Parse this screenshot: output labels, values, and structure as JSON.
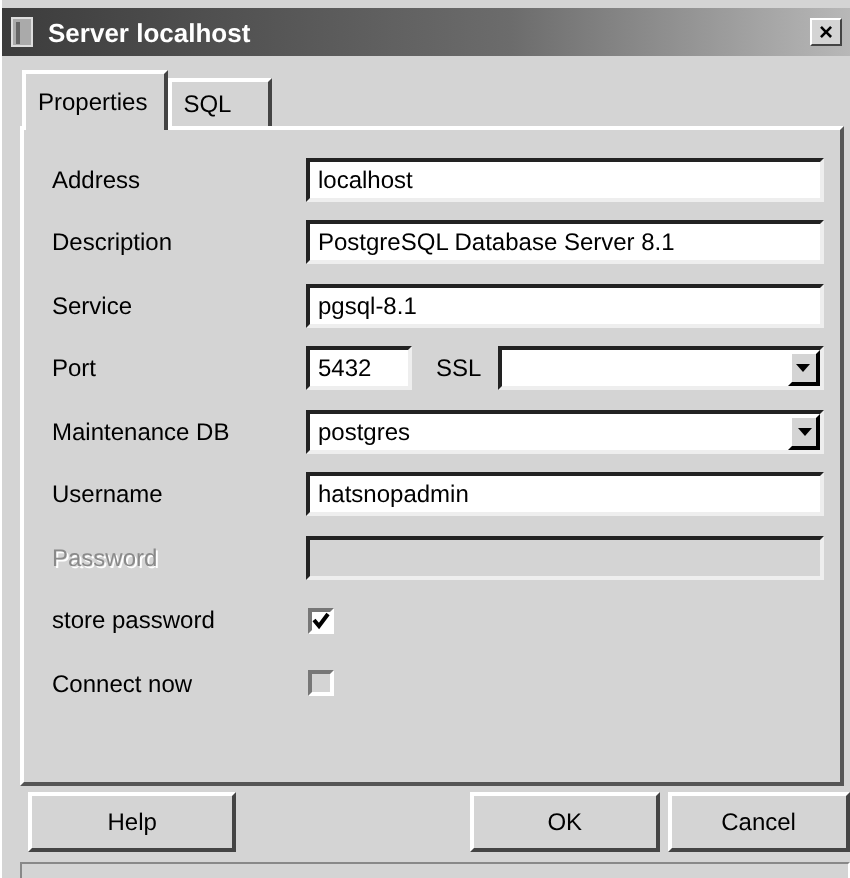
{
  "window": {
    "title": "Server localhost",
    "close": "×"
  },
  "tabs": [
    {
      "label": "Properties",
      "selected": true
    },
    {
      "label": "SQL",
      "selected": false
    }
  ],
  "rows": [
    {
      "kind": "text",
      "label": "Address",
      "value": "localhost",
      "disabled": false
    },
    {
      "kind": "text",
      "label": "Description",
      "value": "PostgreSQL Database Server 8.1",
      "disabled": false
    },
    {
      "kind": "text",
      "label": "Service",
      "value": "pgsql-8.1",
      "disabled": false
    },
    {
      "kind": "port",
      "label": "Port",
      "value": "5432",
      "ssl_label": "SSL"
    },
    {
      "kind": "combo",
      "label": "Maintenance DB",
      "value": "postgres"
    },
    {
      "kind": "text",
      "label": "Username",
      "value": "hatsnopadmin",
      "disabled": false
    },
    {
      "kind": "text",
      "label": "Password",
      "disabled": true
    },
    {
      "kind": "check",
      "label": "store password",
      "checked": true
    },
    {
      "kind": "check",
      "label": "Connect now",
      "checked": false
    }
  ],
  "buttons": [
    {
      "label": "Help"
    },
    {
      "label": "OK"
    },
    {
      "label": "Cancel"
    }
  ]
}
